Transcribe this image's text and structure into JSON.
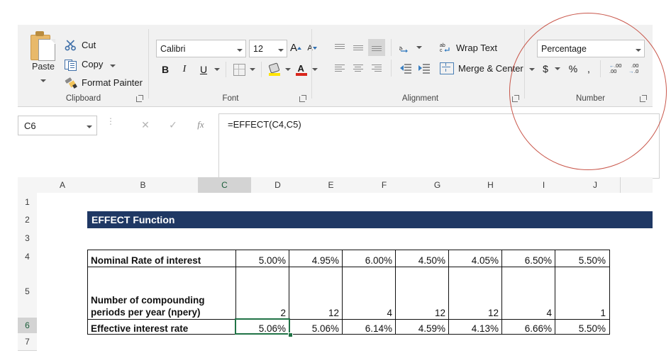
{
  "ribbon": {
    "groups": [
      {
        "name": "Clipboard",
        "label": "Clipboard"
      },
      {
        "name": "Font",
        "label": "Font"
      },
      {
        "name": "Alignment",
        "label": "Alignment"
      },
      {
        "name": "Number",
        "label": "Number"
      }
    ],
    "clipboard": {
      "paste_label": "Paste",
      "cut_label": "Cut",
      "copy_label": "Copy",
      "format_painter_label": "Format Painter",
      "group_label": "Clipboard"
    },
    "font": {
      "font_name": "Calibri",
      "font_size": "12",
      "bold_label": "B",
      "italic_label": "I",
      "underline_label": "U",
      "grow_font_label": "A",
      "shrink_font_label": "A",
      "fill_color": "#ffe400",
      "font_color": "#d9261c",
      "group_label": "Font"
    },
    "alignment": {
      "wrap_text_label": "Wrap Text",
      "merge_center_label": "Merge & Center",
      "group_label": "Alignment",
      "selected_vertical_align": "bottom-align"
    },
    "number": {
      "format_value": "Percentage",
      "currency_label": "$",
      "percent_label": "%",
      "comma_label": ",",
      "increase_decimal_label": ".00",
      "decrease_decimal_label": ".00",
      "group_label": "Number",
      "annotation_color": "#c0392b"
    }
  },
  "formula_bar": {
    "name_box": "C6",
    "formula": "=EFFECT(C4,C5)",
    "cancel_label": "✕",
    "enter_label": "✓",
    "fx_label": "fx"
  },
  "grid": {
    "columns": [
      "A",
      "B",
      "C",
      "D",
      "E",
      "F",
      "G",
      "H",
      "I",
      "J"
    ],
    "active_column": "C",
    "rows": [
      "1",
      "2",
      "3",
      "4",
      "5",
      "6",
      "7"
    ],
    "active_row": "6",
    "selected_cell": "C6",
    "banner": {
      "text": "EFFECT Function",
      "bg": "#1f3864",
      "color": "#ffffff"
    }
  },
  "sheet_table": {
    "row_labels": [
      "Nominal Rate of interest",
      "Number of compounding periods per year (npery)",
      "Effective interest rate"
    ],
    "columns": [
      "C",
      "D",
      "E",
      "F",
      "G",
      "H",
      "I"
    ],
    "nominal_rate": [
      "5.00%",
      "4.95%",
      "6.00%",
      "4.50%",
      "4.05%",
      "6.50%",
      "5.50%"
    ],
    "npery": [
      "2",
      "12",
      "4",
      "12",
      "12",
      "4",
      "1"
    ],
    "effective_rate": [
      "5.06%",
      "5.06%",
      "6.14%",
      "4.59%",
      "4.13%",
      "6.66%",
      "5.50%"
    ]
  }
}
